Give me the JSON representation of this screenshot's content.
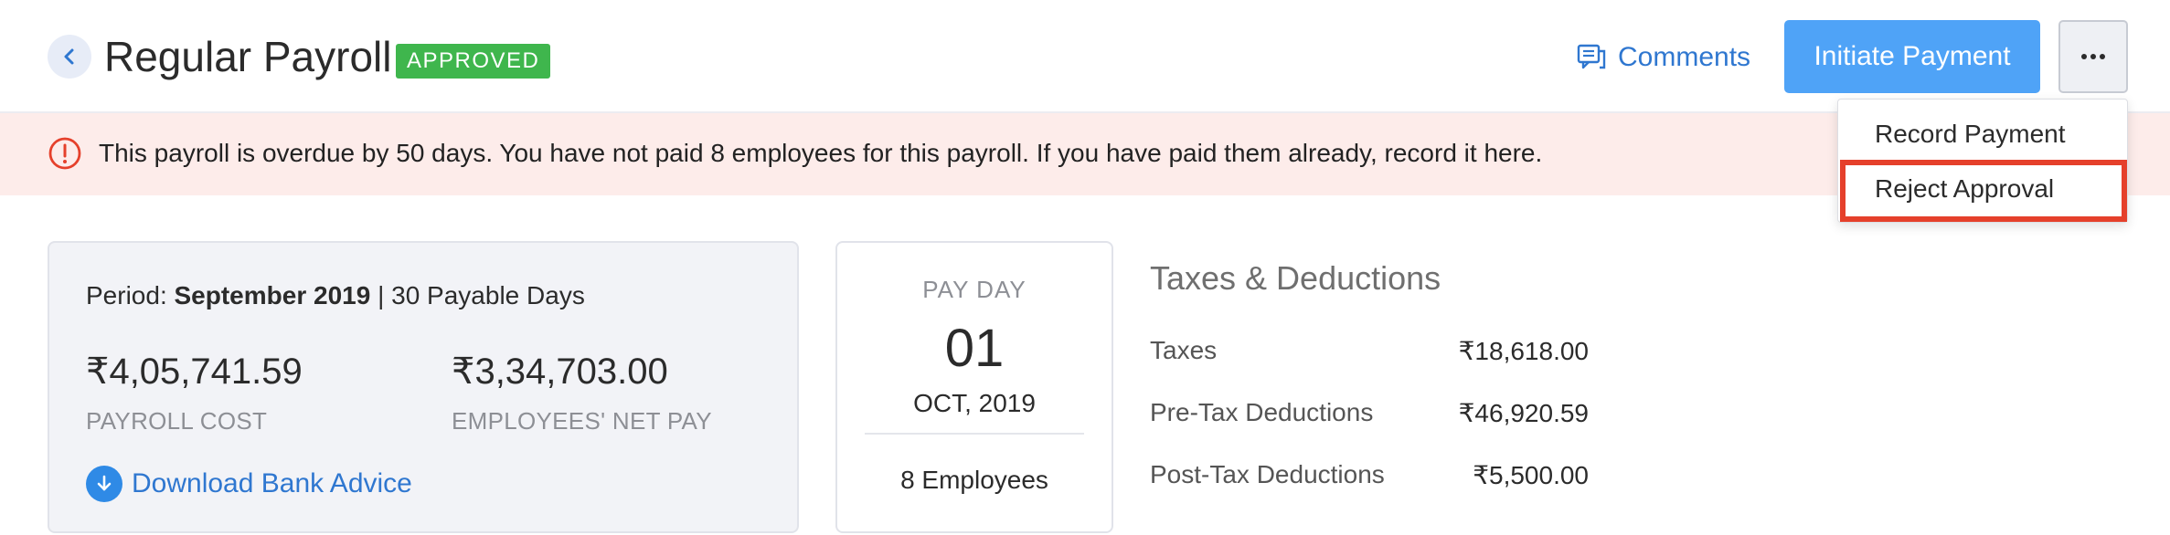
{
  "header": {
    "title": "Regular Payroll",
    "status": "APPROVED",
    "comments_label": "Comments",
    "primary_action": "Initiate Payment",
    "more_label": "..."
  },
  "alert": {
    "text": "This payroll is overdue by 50 days. You have not paid 8 employees for this payroll. If you have paid them already, record it here."
  },
  "summary": {
    "period_prefix": "Period:",
    "period_value": "September 2019",
    "period_suffix": "| 30 Payable Days",
    "payroll_cost": "₹4,05,741.59",
    "payroll_cost_label": "PAYROLL COST",
    "net_pay": "₹3,34,703.00",
    "net_pay_label": "EMPLOYEES' NET PAY",
    "bank_advice_label": "Download Bank Advice"
  },
  "payday": {
    "label": "PAY DAY",
    "day": "01",
    "month_year": "OCT, 2019",
    "employees": "8 Employees"
  },
  "taxes": {
    "title": "Taxes & Deductions",
    "rows": [
      {
        "label": "Taxes",
        "value": "₹18,618.00"
      },
      {
        "label": "Pre-Tax Deductions",
        "value": "₹46,920.59"
      },
      {
        "label": "Post-Tax Deductions",
        "value": "₹5,500.00"
      }
    ]
  },
  "dropdown": {
    "items": [
      {
        "label": "Record Payment"
      },
      {
        "label": "Reject Approval"
      }
    ]
  },
  "colors": {
    "primary": "#4fa3f7",
    "link": "#2f77d0",
    "approved": "#3fb64d",
    "alert_bg": "#fdecea",
    "alert_icon": "#e5402b",
    "highlight": "#e5402b"
  }
}
